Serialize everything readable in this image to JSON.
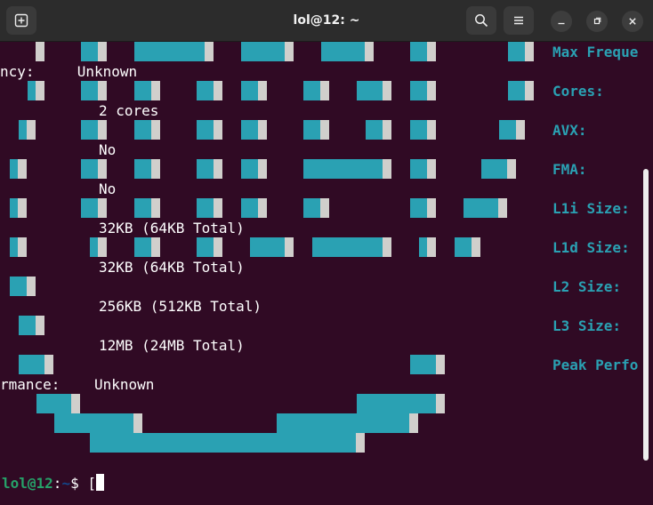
{
  "window": {
    "title": "lol@12: ~",
    "new_tab_icon": "new-tab-icon",
    "search_icon": "search-icon",
    "menu_icon": "hamburger-menu-icon",
    "minimize_icon": "minimize-icon",
    "maximize_icon": "maximize-icon",
    "close_icon": "close-icon"
  },
  "colors": {
    "background": "#300a24",
    "logo_blocks": "#2aa1b3",
    "logo_edge": "#d0cfcc",
    "label_color": "#2aa1b3",
    "prompt_user": "#26a269",
    "prompt_path": "#12488b"
  },
  "output": {
    "lines": [
      {
        "id": "latency",
        "text": "ncy:     Unknown"
      },
      {
        "id": "cores",
        "text": "2 cores"
      },
      {
        "id": "avx",
        "text": "No"
      },
      {
        "id": "fma",
        "text": "No"
      },
      {
        "id": "l1i",
        "text": "32KB (64KB Total)"
      },
      {
        "id": "l1d",
        "text": "32KB (64KB Total)"
      },
      {
        "id": "l2",
        "text": "256KB (512KB Total)"
      },
      {
        "id": "l3",
        "text": "12MB (24MB Total)"
      },
      {
        "id": "peak",
        "text": "rmance:    Unknown"
      }
    ],
    "labels": [
      "Max Freque",
      "Cores:",
      "AVX:",
      "FMA:",
      "L1i Size:",
      "L1d Size:",
      "L2 Size:",
      "L3 Size:",
      "Peak Perfo"
    ]
  },
  "prompt": {
    "user_host": "lol@12",
    "separator": ":",
    "path": "~",
    "symbol": "$ ",
    "typed": "["
  }
}
